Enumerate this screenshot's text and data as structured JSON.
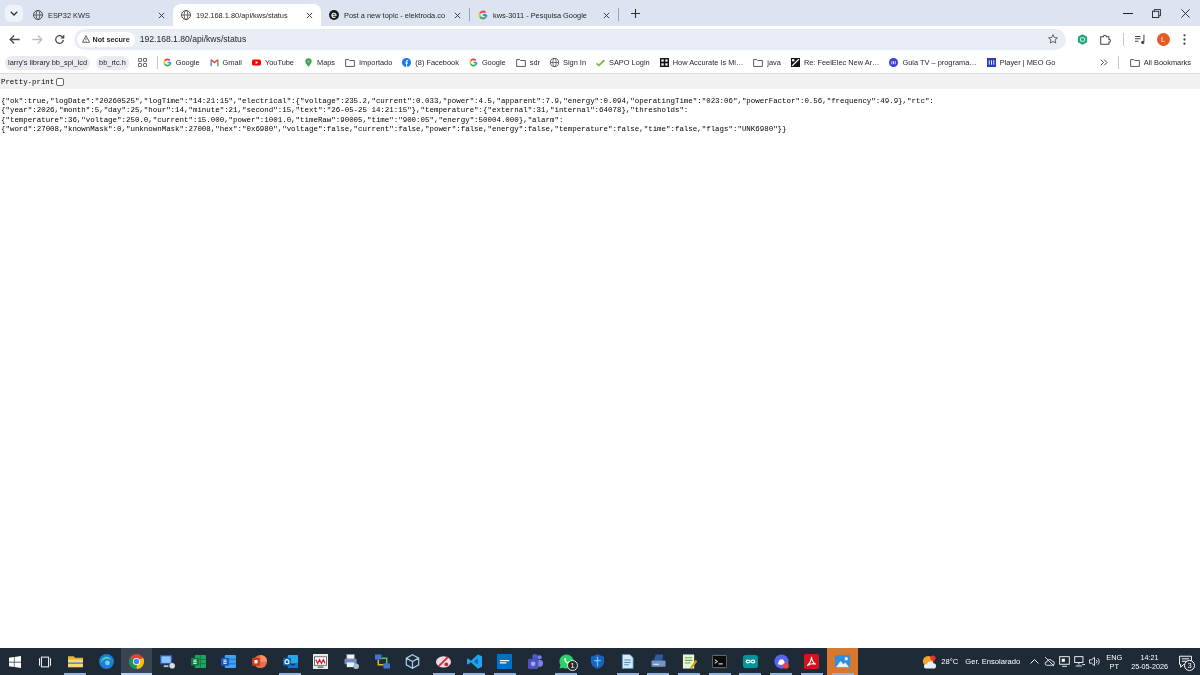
{
  "tabs": [
    {
      "label": "ESP32 KWS",
      "selected": false
    },
    {
      "label": "192.168.1.80/api/kws/status",
      "selected": true
    },
    {
      "label": "Post a new topic - elektroda.co",
      "selected": false
    },
    {
      "label": "kws-3011 - Pesquisa Google",
      "selected": false
    }
  ],
  "toolbar": {
    "back": {
      "disabled": false
    },
    "forward": {
      "disabled": true
    },
    "security_chip": "Not secure",
    "url": "192.168.1.80/api/kws/status",
    "profile_initial": "L"
  },
  "bookmarks_bar": {
    "items": [
      {
        "label": "larry's library bb_spi_lcd",
        "kind": "group"
      },
      {
        "label": "bb_rtc.h",
        "kind": "group"
      },
      {
        "label": "Google",
        "kind": "link"
      },
      {
        "label": "Gmail",
        "kind": "link"
      },
      {
        "label": "YouTube",
        "kind": "link"
      },
      {
        "label": "Maps",
        "kind": "link"
      },
      {
        "label": "Importado",
        "kind": "folder"
      },
      {
        "label": "(8) Facebook",
        "kind": "link"
      },
      {
        "label": "Google",
        "kind": "link"
      },
      {
        "label": "sdr",
        "kind": "folder"
      },
      {
        "label": "Sign In",
        "kind": "link"
      },
      {
        "label": "SAPO Login",
        "kind": "link"
      },
      {
        "label": "How Accurate Is Mi…",
        "kind": "link"
      },
      {
        "label": "java",
        "kind": "folder"
      },
      {
        "label": "Re: FeelElec New Ar…",
        "kind": "link"
      },
      {
        "label": "Guia TV – programa…",
        "kind": "link"
      },
      {
        "label": "Player | MEO Go",
        "kind": "link"
      }
    ],
    "all_bookmarks": "All Bookmarks"
  },
  "page": {
    "pretty_print": {
      "label": "Pretty-print",
      "checked": false
    },
    "body": "{\"ok\":true,\"logDate\":\"20260525\",\"logTime\":\"14:21:15\",\"electrical\":{\"voltage\":235.2,\"current\":0.033,\"power\":4.5,\"apparent\":7.9,\"energy\":0.094,\"operatingTime\":\"023:06\",\"powerFactor\":0.56,\"frequency\":49.9},\"rtc\":{\"year\":2026,\"month\":5,\"day\":25,\"hour\":14,\"minute\":21,\"second\":15,\"text\":\"26-05-25 14:21:15\"},\"temperature\":{\"external\":31,\"internal\":64078},\"thresholds\":{\"temperature\":36,\"voltage\":250.0,\"current\":15.000,\"power\":1001.0,\"timeRaw\":90005,\"time\":\"900:05\",\"energy\":50004.000},\"alarm\":{\"word\":27008,\"knownMask\":0,\"unknownMask\":27008,\"hex\":\"0x6980\",\"voltage\":false,\"current\":false,\"power\":false,\"energy\":false,\"temperature\":false,\"time\":false,\"flags\":\"UNK6980\"}}"
  },
  "taskbar": {
    "apps": [
      {
        "running": true,
        "selected": false,
        "flashing": false
      },
      {
        "running": false,
        "selected": false,
        "flashing": false
      },
      {
        "running": true,
        "selected": true,
        "flashing": false
      },
      {
        "running": false,
        "selected": false,
        "flashing": false
      },
      {
        "running": false,
        "selected": false,
        "flashing": false
      },
      {
        "running": false,
        "selected": false,
        "flashing": false
      },
      {
        "running": false,
        "selected": false,
        "flashing": false
      },
      {
        "running": true,
        "selected": false,
        "flashing": false
      },
      {
        "running": false,
        "selected": false,
        "flashing": false
      },
      {
        "running": false,
        "selected": false,
        "flashing": false
      },
      {
        "running": false,
        "selected": false,
        "flashing": false
      },
      {
        "running": false,
        "selected": false,
        "flashing": false
      },
      {
        "running": true,
        "selected": false,
        "flashing": false
      },
      {
        "running": true,
        "selected": false,
        "flashing": false
      },
      {
        "running": true,
        "selected": false,
        "flashing": false
      },
      {
        "running": false,
        "selected": false,
        "flashing": false
      },
      {
        "running": true,
        "selected": false,
        "flashing": false,
        "badge": "1"
      },
      {
        "running": false,
        "selected": false,
        "flashing": false
      },
      {
        "running": true,
        "selected": false,
        "flashing": false
      },
      {
        "running": true,
        "selected": false,
        "flashing": false
      },
      {
        "running": true,
        "selected": false,
        "flashing": false
      },
      {
        "running": true,
        "selected": false,
        "flashing": false
      },
      {
        "running": true,
        "selected": false,
        "flashing": false
      },
      {
        "running": true,
        "selected": false,
        "flashing": false
      },
      {
        "running": true,
        "selected": false,
        "flashing": false
      },
      {
        "running": true,
        "selected": false,
        "flashing": true
      }
    ],
    "weather": {
      "temperature": "28°C",
      "summary": "Ger. Ensolarado"
    },
    "language": {
      "input": "ENG",
      "layout": "PT"
    },
    "clock": {
      "time": "14:21",
      "date": "25-05-2026"
    },
    "notifications": {
      "count": "3"
    }
  }
}
